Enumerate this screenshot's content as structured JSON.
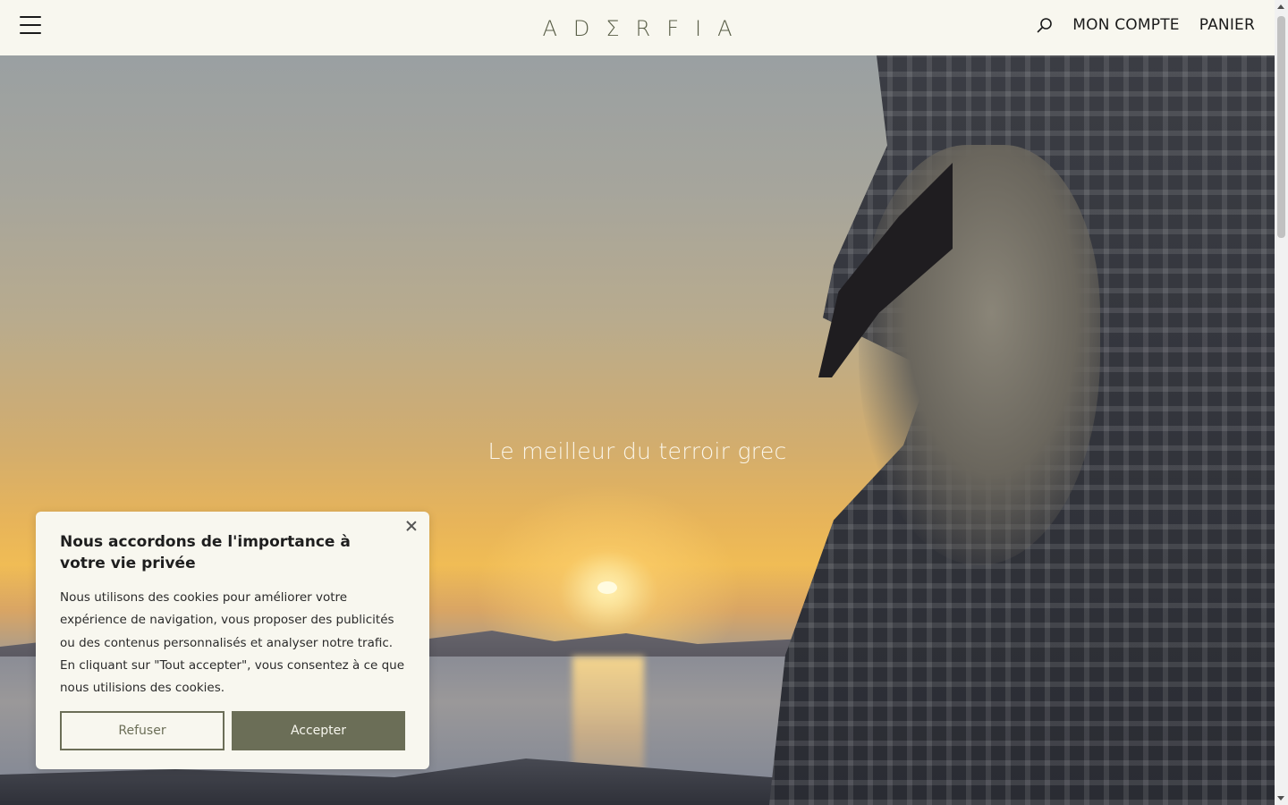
{
  "header": {
    "logo": "ADΣRFIA",
    "menu_icon": "hamburger-menu-icon",
    "search_icon": "search-icon",
    "account_label": "MON COMPTE",
    "cart_label": "PANIER"
  },
  "hero": {
    "tagline": "Le meilleur du terroir grec"
  },
  "cookie_banner": {
    "title": "Nous accordons de l'importance à votre vie privée",
    "body": "Nous utilisons des cookies pour améliorer votre expérience de navigation, vous proposer des publicités ou des contenus personnalisés et analyser notre trafic. En cliquant sur \"Tout accepter\", vous consentez à ce que nous utilisions des cookies.",
    "refuse_label": "Refuser",
    "accept_label": "Accepter",
    "close_icon": "close-icon"
  },
  "colors": {
    "background": "#f8f7ef",
    "accent": "#6b6e57",
    "logo": "#5a5f48"
  }
}
